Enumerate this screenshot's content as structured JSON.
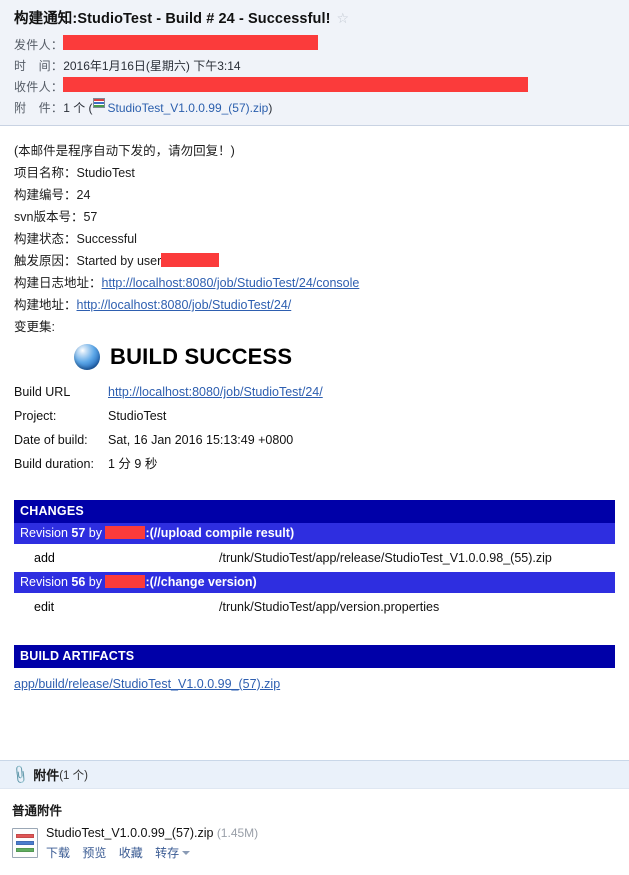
{
  "mail": {
    "subject": "构建通知:StudioTest - Build # 24 - Successful!",
    "star_icon": "star-outline-icon",
    "fields": {
      "sender_label": "发件人：",
      "sender_value_redacted": true,
      "date_label": "时　间：",
      "date_value": "2016年1月16日(星期六) 下午3:14",
      "receiver_label": "收件人：",
      "receiver_value_redacted": true,
      "attachment_label": "附　件：",
      "attachment_count_text": "1 个 (",
      "attachment_name": "StudioTest_V1.0.0.99_(57).zip",
      "attachment_close": ")"
    }
  },
  "body": {
    "notice": "(本邮件是程序自动下发的，请勿回复！)",
    "rows": [
      {
        "label": "项目名称：",
        "value": "StudioTest"
      },
      {
        "label": "构建编号：",
        "value": "24"
      },
      {
        "label": "svn版本号：",
        "value": "57"
      },
      {
        "label": "构建状态：",
        "value": "Successful"
      },
      {
        "label": "触发原因：",
        "value": "Started by user",
        "redacted_suffix": true
      }
    ],
    "log_label": "构建日志地址：",
    "log_url": "http://localhost:8080/job/StudioTest/24/console",
    "build_label": "构建地址：",
    "build_url": "http://localhost:8080/job/StudioTest/24/",
    "changeset_label": "变更集:"
  },
  "jenkins": {
    "status_title": "BUILD SUCCESS",
    "status_icon": "blue-ball-icon",
    "summary": [
      {
        "key": "Build URL",
        "value": "http://localhost:8080/job/StudioTest/24/",
        "is_link": true
      },
      {
        "key": "Project:",
        "value": "StudioTest",
        "is_link": false
      },
      {
        "key": "Date of build:",
        "value": "Sat, 16 Jan 2016 15:13:49 +0800",
        "is_link": false
      },
      {
        "key": "Build duration:",
        "value": "1 分 9 秒",
        "is_link": false
      }
    ],
    "changes": {
      "section_title": "CHANGES",
      "revisions": [
        {
          "prefix": "Revision ",
          "number": "57",
          "by": " by ",
          "author_redacted": true,
          "message": ":(//upload compile result)",
          "files": [
            {
              "op": "add",
              "path": "/trunk/StudioTest/app/release/StudioTest_V1.0.0.98_(55).zip"
            }
          ]
        },
        {
          "prefix": "Revision ",
          "number": "56",
          "by": " by ",
          "author_redacted": true,
          "message": ":(//change version)",
          "files": [
            {
              "op": "edit",
              "path": "/trunk/StudioTest/app/version.properties"
            }
          ]
        }
      ]
    },
    "artifacts": {
      "section_title": "BUILD ARTIFACTS",
      "items": [
        "app/build/release/StudioTest_V1.0.0.99_(57).zip"
      ]
    }
  },
  "attachments_panel": {
    "clip_icon": "paperclip-icon",
    "title": "附件",
    "count_text": "(1 个)",
    "group_title": "普通附件",
    "items": [
      {
        "file_icon": "zip-file-icon",
        "name": "StudioTest_V1.0.0.99_(57).zip",
        "size": "(1.45M)",
        "actions": [
          "下载",
          "预览",
          "收藏",
          "转存"
        ],
        "has_caret": true
      }
    ]
  },
  "colors": {
    "header_bg": "#f0f3f9",
    "jenkins_section": "#0000a8",
    "jenkins_revision": "#2e2ee0",
    "link": "#2e5fb0",
    "redaction": "#fb3b3b",
    "attachment_bar_bg": "#eaf1fa"
  }
}
